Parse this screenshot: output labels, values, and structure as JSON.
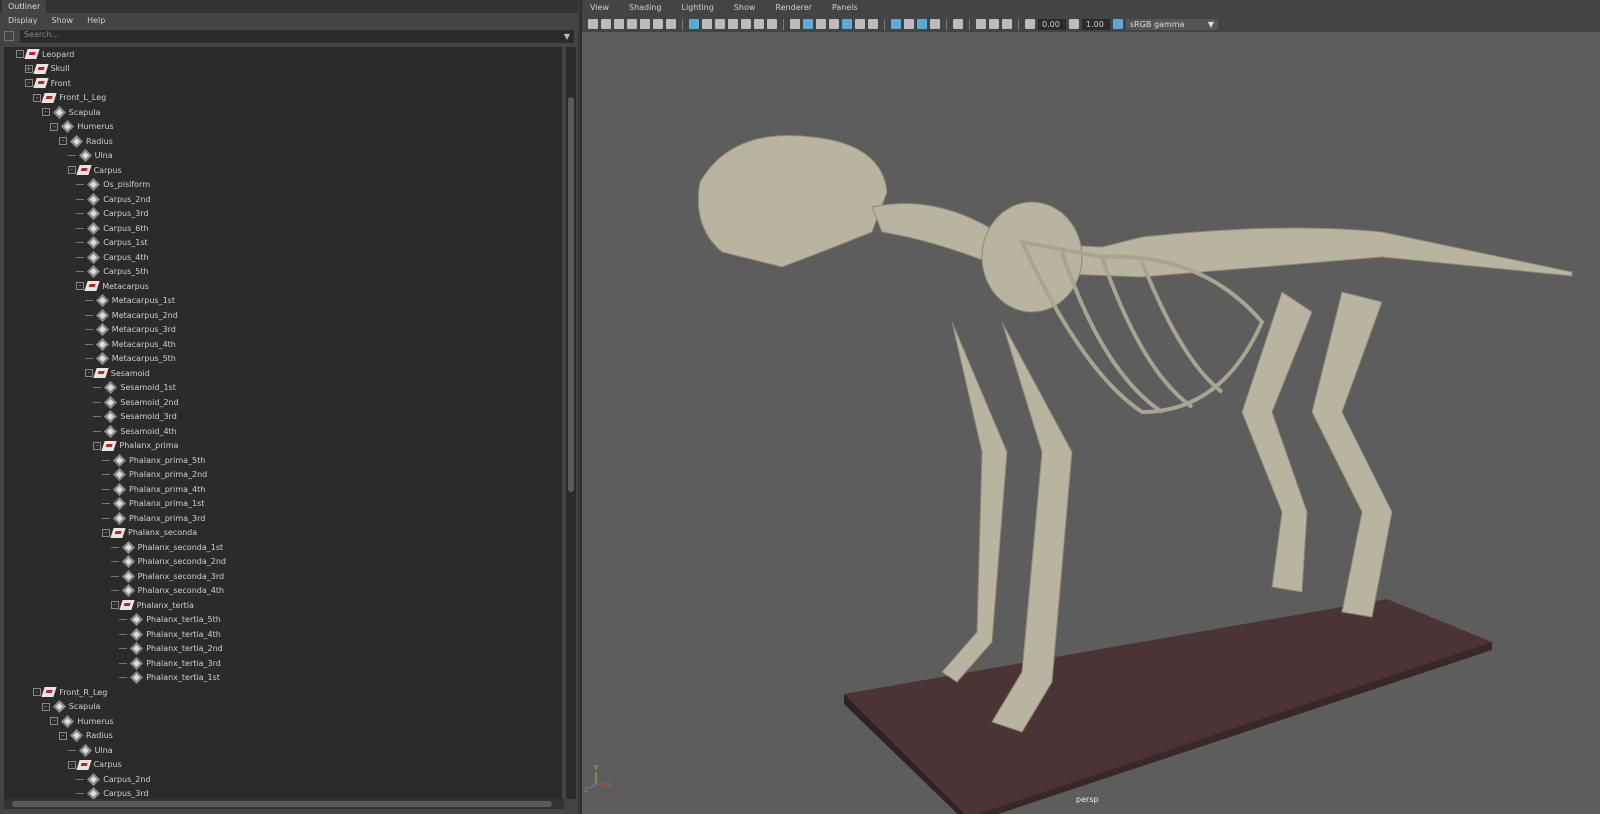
{
  "outliner": {
    "tab": "Outliner",
    "menu": [
      "Display",
      "Show",
      "Help"
    ],
    "search_placeholder": "Search..."
  },
  "tree": [
    {
      "l": 0,
      "t": "g",
      "n": "Leopard",
      "e": "-"
    },
    {
      "l": 1,
      "t": "g",
      "n": "Skull",
      "e": "+"
    },
    {
      "l": 1,
      "t": "g",
      "n": "Front",
      "e": "-"
    },
    {
      "l": 2,
      "t": "g",
      "n": "Front_L_Leg",
      "e": "-"
    },
    {
      "l": 3,
      "t": "j",
      "n": "Scapula",
      "e": "-"
    },
    {
      "l": 4,
      "t": "j",
      "n": "Humerus",
      "e": "-"
    },
    {
      "l": 5,
      "t": "j",
      "n": "Radius",
      "e": "-"
    },
    {
      "l": 6,
      "t": "j",
      "n": "Ulna"
    },
    {
      "l": 6,
      "t": "g",
      "n": "Carpus",
      "e": "-"
    },
    {
      "l": 7,
      "t": "j",
      "n": "Os_pisiform"
    },
    {
      "l": 7,
      "t": "j",
      "n": "Carpus_2nd"
    },
    {
      "l": 7,
      "t": "j",
      "n": "Carpus_3rd"
    },
    {
      "l": 7,
      "t": "j",
      "n": "Carpus_6th"
    },
    {
      "l": 7,
      "t": "j",
      "n": "Carpus_1st"
    },
    {
      "l": 7,
      "t": "j",
      "n": "Carpus_4th"
    },
    {
      "l": 7,
      "t": "j",
      "n": "Carpus_5th"
    },
    {
      "l": 7,
      "t": "g",
      "n": "Metacarpus",
      "e": "-"
    },
    {
      "l": 8,
      "t": "j",
      "n": "Metacarpus_1st"
    },
    {
      "l": 8,
      "t": "j",
      "n": "Metacarpus_2nd"
    },
    {
      "l": 8,
      "t": "j",
      "n": "Metacarpus_3rd"
    },
    {
      "l": 8,
      "t": "j",
      "n": "Metacarpus_4th"
    },
    {
      "l": 8,
      "t": "j",
      "n": "Metacarpus_5th"
    },
    {
      "l": 8,
      "t": "g",
      "n": "Sesamoid",
      "e": "-"
    },
    {
      "l": 9,
      "t": "j",
      "n": "Sesamoid_1st"
    },
    {
      "l": 9,
      "t": "j",
      "n": "Sesamoid_2nd"
    },
    {
      "l": 9,
      "t": "j",
      "n": "Sesamoid_3rd"
    },
    {
      "l": 9,
      "t": "j",
      "n": "Sesamoid_4th"
    },
    {
      "l": 9,
      "t": "g",
      "n": "Phalanx_prima",
      "e": "-"
    },
    {
      "l": 10,
      "t": "j",
      "n": "Phalanx_prima_5th"
    },
    {
      "l": 10,
      "t": "j",
      "n": "Phalanx_prima_2nd"
    },
    {
      "l": 10,
      "t": "j",
      "n": "Phalanx_prima_4th"
    },
    {
      "l": 10,
      "t": "j",
      "n": "Phalanx_prima_1st"
    },
    {
      "l": 10,
      "t": "j",
      "n": "Phalanx_prima_3rd"
    },
    {
      "l": 10,
      "t": "g",
      "n": "Phalanx_seconda",
      "e": "-"
    },
    {
      "l": 11,
      "t": "j",
      "n": "Phalanx_seconda_1st"
    },
    {
      "l": 11,
      "t": "j",
      "n": "Phalanx_seconda_2nd"
    },
    {
      "l": 11,
      "t": "j",
      "n": "Phalanx_seconda_3rd"
    },
    {
      "l": 11,
      "t": "j",
      "n": "Phalanx_seconda_4th"
    },
    {
      "l": 11,
      "t": "g",
      "n": "Phalanx_tertia",
      "e": "-"
    },
    {
      "l": 12,
      "t": "j",
      "n": "Phalanx_tertia_5th"
    },
    {
      "l": 12,
      "t": "j",
      "n": "Phalanx_tertia_4th"
    },
    {
      "l": 12,
      "t": "j",
      "n": "Phalanx_tertia_2nd"
    },
    {
      "l": 12,
      "t": "j",
      "n": "Phalanx_tertia_3rd"
    },
    {
      "l": 12,
      "t": "j",
      "n": "Phalanx_tertia_1st"
    },
    {
      "l": 2,
      "t": "g",
      "n": "Front_R_Leg",
      "e": "-"
    },
    {
      "l": 3,
      "t": "j",
      "n": "Scapula",
      "e": "-"
    },
    {
      "l": 4,
      "t": "j",
      "n": "Humerus",
      "e": "-"
    },
    {
      "l": 5,
      "t": "j",
      "n": "Radius",
      "e": "-"
    },
    {
      "l": 6,
      "t": "j",
      "n": "Ulna"
    },
    {
      "l": 6,
      "t": "g",
      "n": "Carpus",
      "e": "-"
    },
    {
      "l": 7,
      "t": "j",
      "n": "Carpus_2nd"
    },
    {
      "l": 7,
      "t": "j",
      "n": "Carpus_3rd"
    }
  ],
  "viewport": {
    "menu": [
      "View",
      "Shading",
      "Lighting",
      "Show",
      "Renderer",
      "Panels"
    ],
    "exposure": "0.00",
    "gamma": "1.00",
    "color_space": "sRGB gamma",
    "camera": "persp",
    "axis": {
      "x": "X",
      "y": "Y",
      "z": "Z"
    }
  },
  "colors": {
    "bone": "#b9b4a0",
    "base": "#4a3436",
    "accent": "#5aa9d6"
  }
}
